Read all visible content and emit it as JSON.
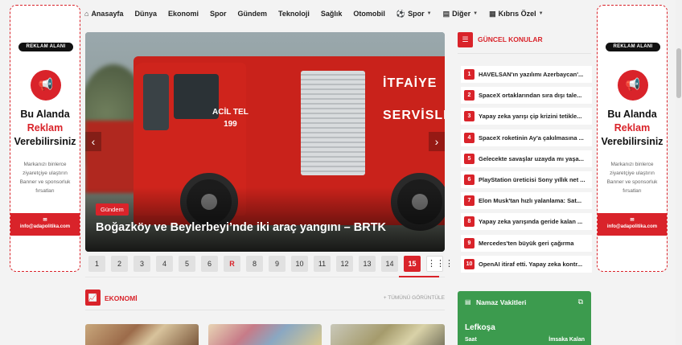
{
  "nav": {
    "items": [
      {
        "label": "Anasayfa",
        "icon": "home-icon"
      },
      {
        "label": "Dünya"
      },
      {
        "label": "Ekonomi"
      },
      {
        "label": "Spor"
      },
      {
        "label": "Gündem"
      },
      {
        "label": "Teknoloji"
      },
      {
        "label": "Sağlık"
      },
      {
        "label": "Otomobil"
      },
      {
        "label": "Spor",
        "icon": "ball-icon",
        "dropdown": true
      },
      {
        "label": "Diğer",
        "icon": "chart-icon",
        "dropdown": true
      },
      {
        "label": "Kıbrıs Özel",
        "icon": "grid-icon",
        "dropdown": true
      }
    ]
  },
  "ad": {
    "label": "REKLAM ALANI",
    "title_line1": "Bu Alanda",
    "title_line2": "Reklam",
    "title_line3": "Verebilirsiniz",
    "text": "Markanızı binlerce ziyaretçiye ulaştırın Banner ve sponsorluk fırsatları",
    "email": "info@adapolitika.com"
  },
  "slider": {
    "category": "Gündem",
    "title": "Boğazköy ve Beylerbeyi’nde iki araç yangını – BRTK",
    "truck_acil": "ACİL TEL",
    "truck_phone": "199",
    "truck_side1": "İTFAİYE",
    "truck_side2": "SERVİSLER"
  },
  "pagination": {
    "pages": [
      "1",
      "2",
      "3",
      "4",
      "5",
      "6",
      "R",
      "8",
      "9",
      "10",
      "11",
      "12",
      "13",
      "14",
      "15"
    ],
    "active": "15"
  },
  "ekonomi": {
    "title": "EKONOMİ",
    "see_all": "+ TÜMÜNÜ GÖRÜNTÜLE"
  },
  "guncel": {
    "title": "GÜNCEL KONULAR",
    "items": [
      "HAVELSAN'ın yazılımı Azerbaycan'...",
      "SpaceX ortaklarından sıra dışı tale...",
      "Yapay zeka yarışı çip krizini tetikle...",
      "SpaceX roketinin Ay'a çakılmasına ...",
      "Gelecekte savaşlar uzayda mı yaşa...",
      "PlayStation üreticisi Sony yıllık net ...",
      "Elon Musk'tan hızlı yalanlama: Sat...",
      "Yapay zeka yarışında geride kalan ...",
      "Mercedes'ten büyük geri çağırma",
      "OpenAI itiraf etti. Yapay zeka kontr..."
    ]
  },
  "namaz": {
    "title": "Namaz Vakitleri",
    "city": "Lefkoşa",
    "col_left": "Saat",
    "col_right": "İmsaka Kalan"
  },
  "colors": {
    "accent": "#d9232a",
    "namaz": "#3c9b4e"
  }
}
